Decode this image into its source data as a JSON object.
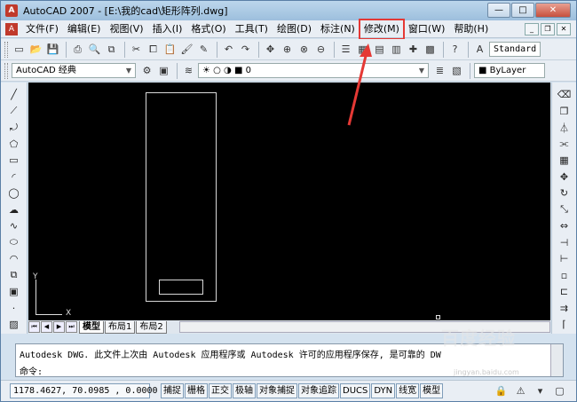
{
  "window": {
    "title": "AutoCAD 2007 - [E:\\我的cad\\矩形阵列.dwg]",
    "controls": [
      "—",
      "□",
      "✕"
    ]
  },
  "menu": {
    "items": [
      "文件(F)",
      "编辑(E)",
      "视图(V)",
      "插入(I)",
      "格式(O)",
      "工具(T)",
      "绘图(D)",
      "标注(N)",
      "修改(M)",
      "窗口(W)",
      "帮助(H)"
    ],
    "highlighted": "修改(M)"
  },
  "toolbar": {
    "text_style": "Standard",
    "workspace": "AutoCAD 经典",
    "layer": "0",
    "color": "ByLayer"
  },
  "layout_tabs": [
    "模型",
    "布局1",
    "布局2"
  ],
  "active_tab": "模型",
  "ucs": {
    "x_label": "X",
    "y_label": "Y"
  },
  "command": {
    "line1": "Autodesk DWG.  此文件上次由 Autodesk 应用程序或 Autodesk 许可的应用程序保存, 是可靠的 DW",
    "prompt": "命令:"
  },
  "status": {
    "coords": "1178.4627, 70.0985 , 0.0000",
    "buttons": [
      "捕捉",
      "栅格",
      "正交",
      "极轴",
      "对象捕捉",
      "对象追踪",
      "DUCS",
      "DYN",
      "线宽",
      "模型"
    ]
  },
  "watermark": {
    "main": "百度经验",
    "sub": "jingyan.baidu.com"
  },
  "colors": {
    "highlight": "#e53935",
    "canvas": "#000000"
  }
}
